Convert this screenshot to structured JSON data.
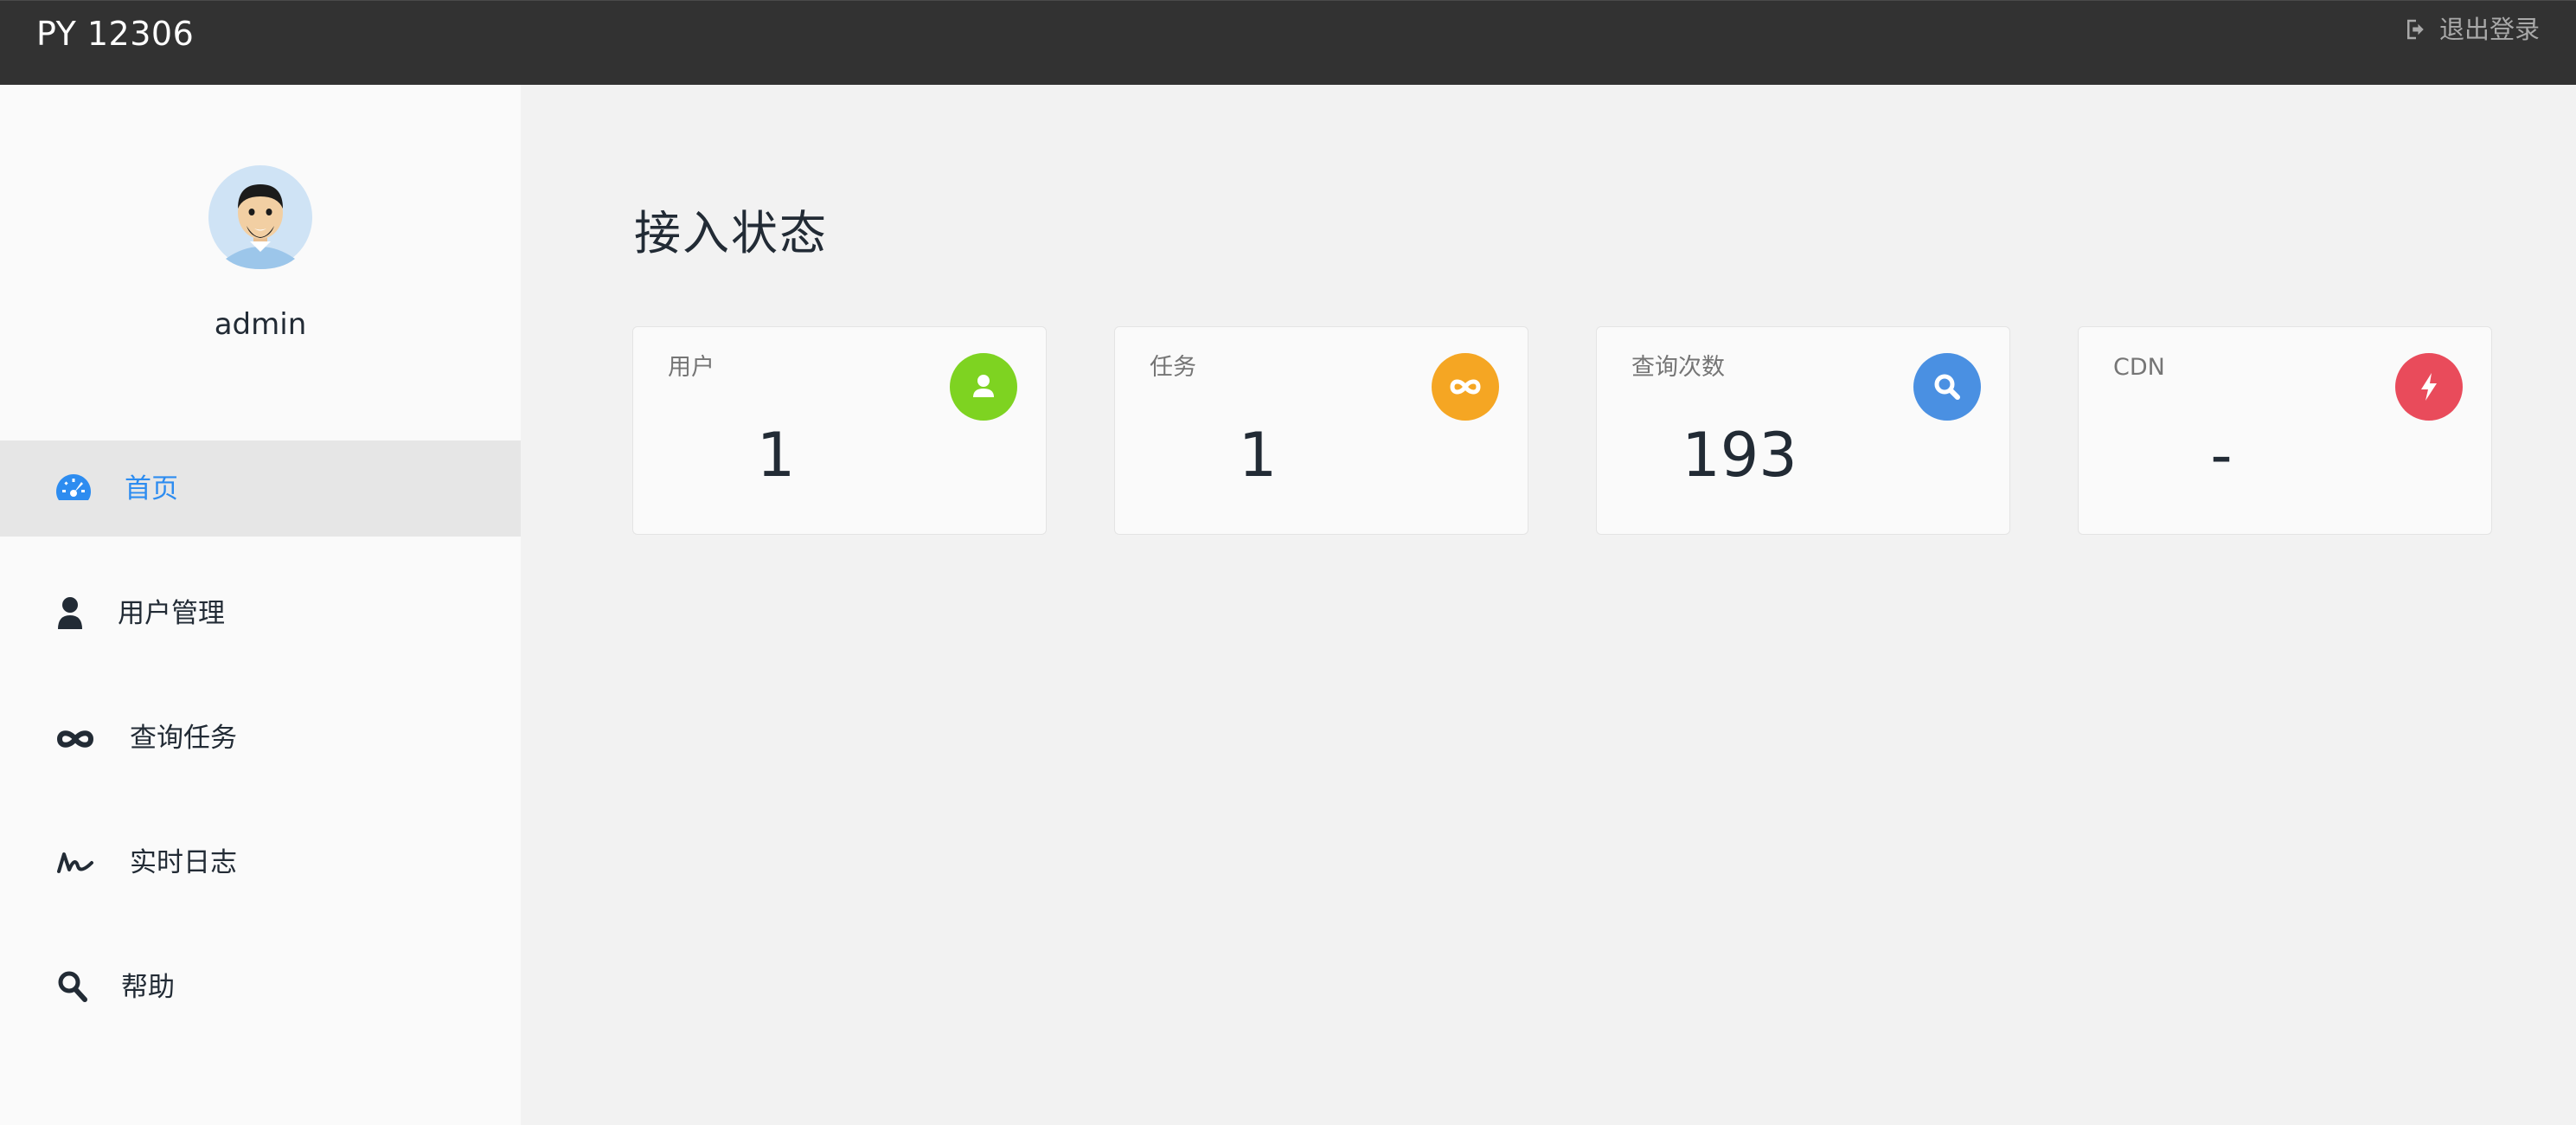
{
  "header": {
    "brand": "PY 12306",
    "logout_label": "退出登录",
    "logout_icon": "sign-out-icon"
  },
  "sidebar": {
    "username": "admin",
    "active_color": "#2d8cf0",
    "items": [
      {
        "label": "首页",
        "icon": "dashboard-icon",
        "active": true
      },
      {
        "label": "用户管理",
        "icon": "user-icon",
        "active": false
      },
      {
        "label": "查询任务",
        "icon": "infinity-icon",
        "active": false
      },
      {
        "label": "实时日志",
        "icon": "signature-icon",
        "active": false
      },
      {
        "label": "帮助",
        "icon": "search-icon",
        "active": false
      }
    ]
  },
  "main": {
    "title": "接入状态",
    "cards": [
      {
        "label": "用户",
        "value": "1",
        "icon": "user-icon",
        "color": "#7ed321"
      },
      {
        "label": "任务",
        "value": "1",
        "icon": "infinity-icon",
        "color": "#f5a623"
      },
      {
        "label": "查询次数",
        "value": "193",
        "icon": "search-icon",
        "color": "#4a90e2"
      },
      {
        "label": "CDN",
        "value": "-",
        "icon": "bolt-icon",
        "color": "#e94b5b"
      }
    ]
  }
}
